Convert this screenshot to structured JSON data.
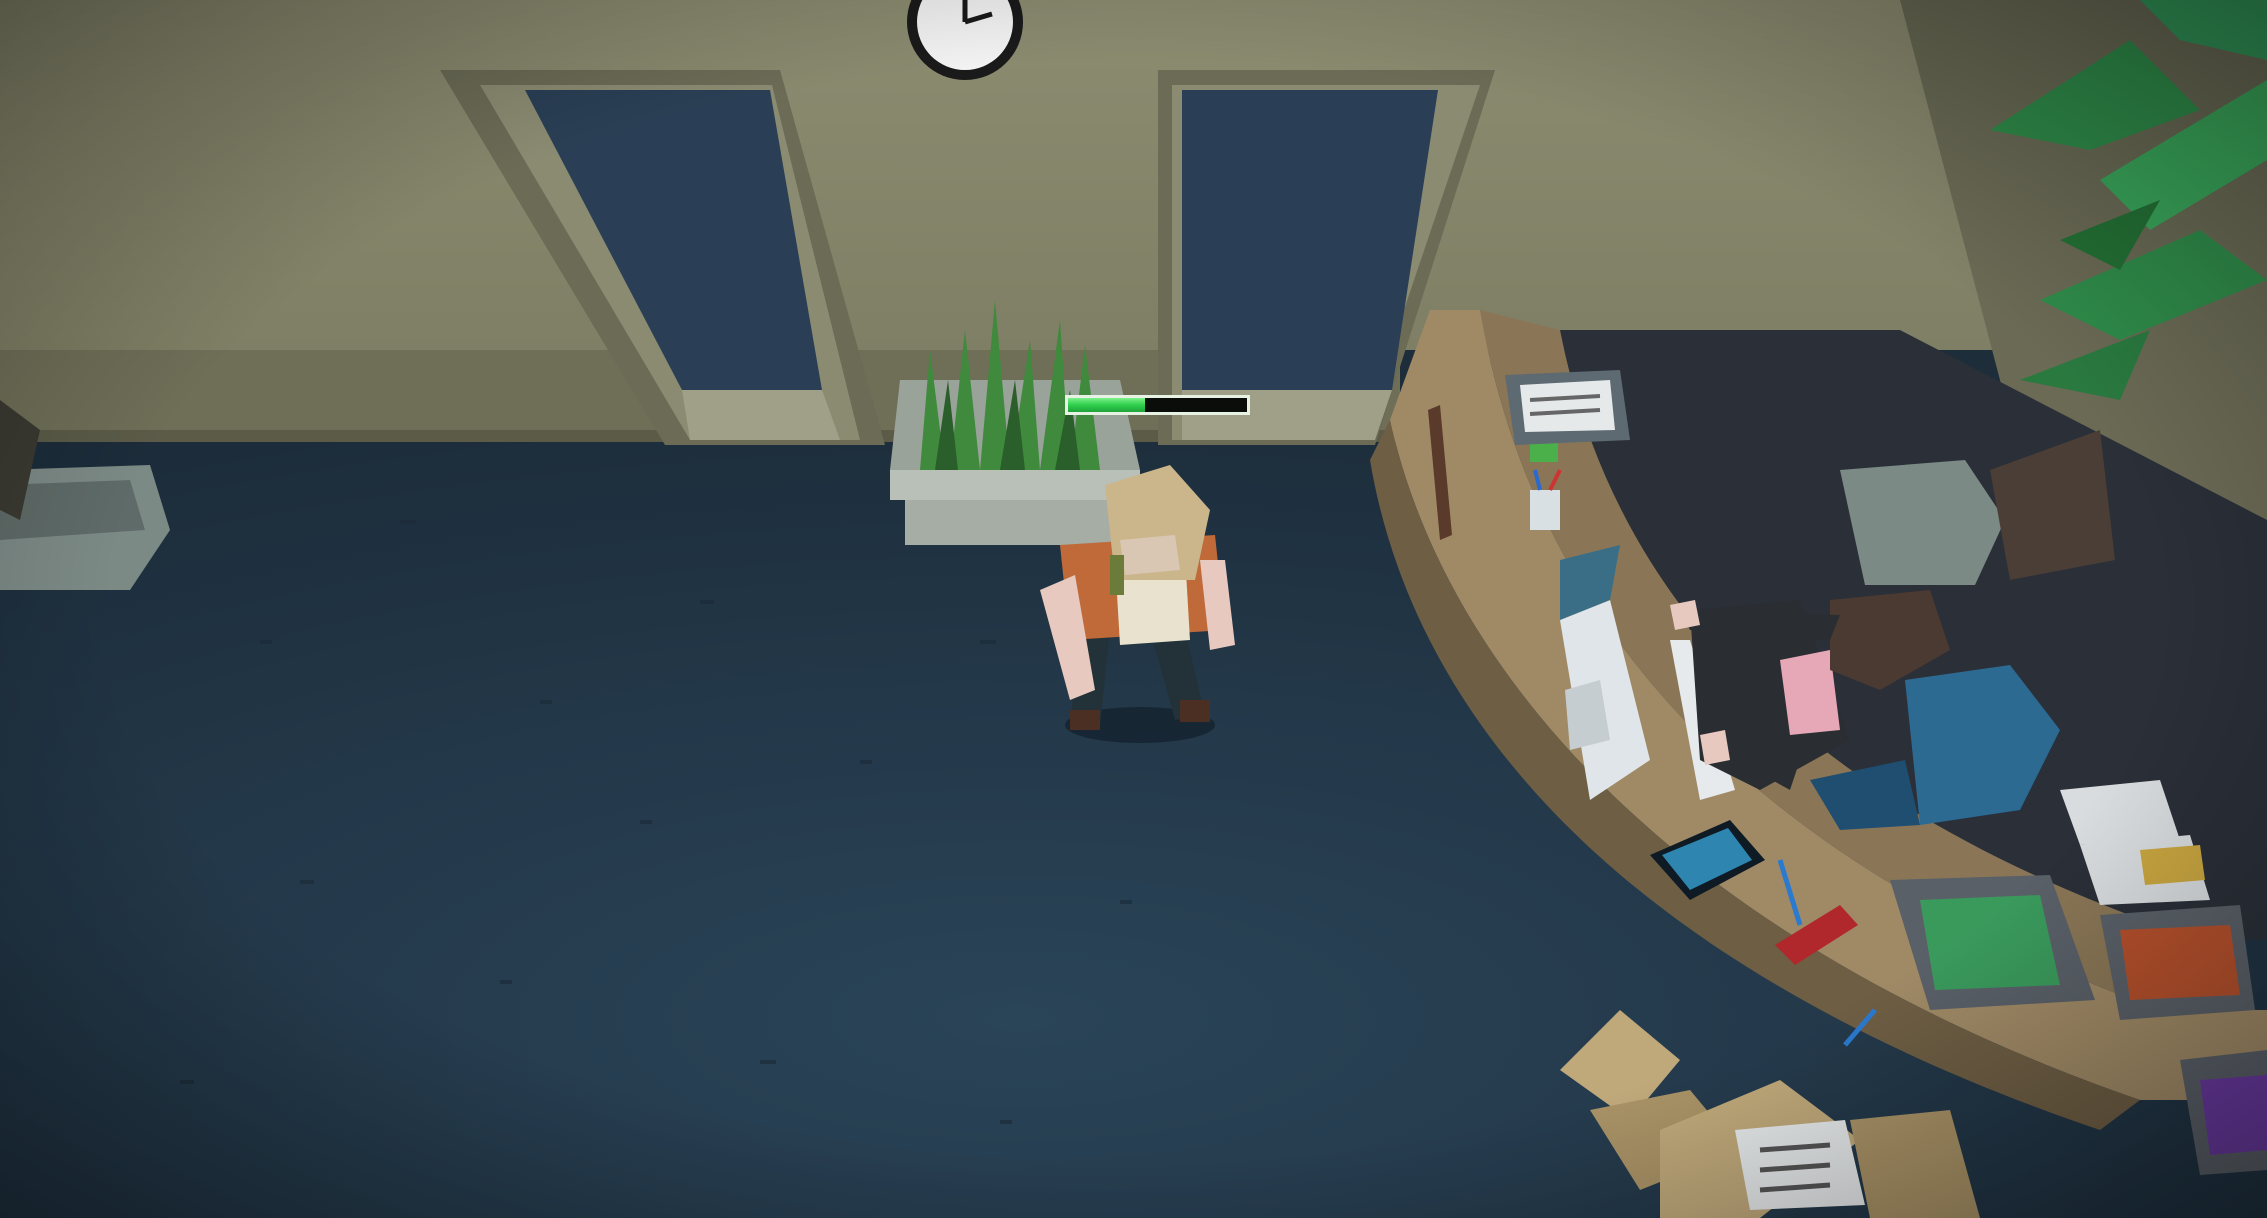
{
  "hud": {
    "progress_fraction": 0.43,
    "progress_color": "#2ecf4d"
  },
  "scene": {
    "wall_color": "#8a8a6e",
    "carpet_color": "#22364a",
    "desk_color": "#8a7656"
  },
  "icons": [
    "wall-clock-icon"
  ]
}
